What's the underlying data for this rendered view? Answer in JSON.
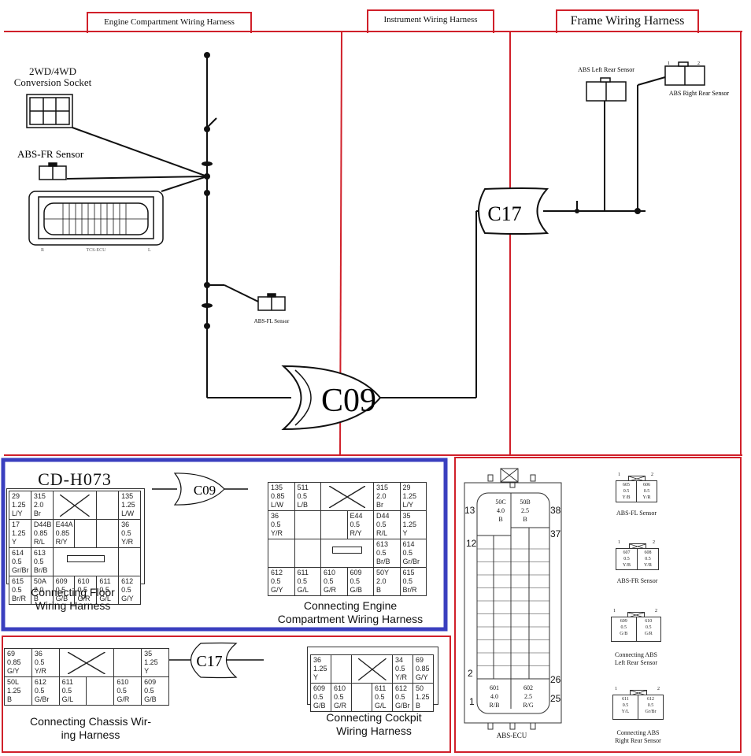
{
  "headers": {
    "engine": "Engine Compartment Wiring Harness",
    "instrument": "Instrument Wiring Harness",
    "frame": "Frame Wiring Harness"
  },
  "colors": {
    "frame_red": "#d0202a",
    "highlight_blue": "#3a3fbf"
  },
  "top_diagram": {
    "conversion_socket": "2WD/4WD\nConversion Socket",
    "abs_fr_sensor": "ABS-FR Sensor",
    "tcs_ecu": "TCS-ECU",
    "tcs_left": "R",
    "tcs_right": "L",
    "abs_fl_sensor": "ABS-FL Sensor",
    "connector_c09": "C09",
    "connector_c17": "C17",
    "abs_left_rear": "ABS Left Rear Sensor",
    "abs_right_rear": "ABS Right Rear Sensor",
    "pin1": "1",
    "pin2": "2"
  },
  "floor_harness": {
    "code": "CD-H073",
    "label": "Connecting Floor\nWiring Harness",
    "rows": [
      [
        {
          "t": "29\n1.25\nL/Y"
        },
        {
          "t": "315\n2.0\nBr"
        },
        {
          "k": "cross",
          "span": 2
        },
        {
          "t": ""
        },
        {
          "t": "135\n1.25\nL/W"
        }
      ],
      [
        {
          "t": "17\n1.25\nY"
        },
        {
          "t": "D44B\n0.85\nR/L"
        },
        {
          "t": "E44A\n0.85\nR/Y"
        },
        {
          "t": ""
        },
        {
          "t": ""
        },
        {
          "t": "36\n0.5\nY/R"
        }
      ],
      [
        {
          "t": "614\n0.5\nGr/Br"
        },
        {
          "t": "613\n0.5\nBr/B"
        },
        {
          "k": "bar",
          "span": 3
        },
        {
          "t": ""
        }
      ],
      [
        {
          "t": "615\n0.5\nBr/R"
        },
        {
          "t": "50A\n2.0\nB"
        },
        {
          "t": "609\n0.5\nG/B"
        },
        {
          "t": "610\n0.5\nG/R"
        },
        {
          "t": "611\n0.5\nG/L"
        },
        {
          "t": "612\n0.5\nG/Y"
        }
      ]
    ]
  },
  "link_c09": "C09",
  "engine_harness": {
    "label": "Connecting Engine\nCompartment Wiring Harness",
    "rows": [
      [
        {
          "t": "135\n0.85\nL/W"
        },
        {
          "t": "511\n0.5\nL/B"
        },
        {
          "k": "cross",
          "span": 2
        },
        {
          "t": "315\n2.0\nBr"
        },
        {
          "t": "29\n1.25\nL/Y"
        }
      ],
      [
        {
          "t": "36\n0.5\nY/R"
        },
        {
          "t": ""
        },
        {
          "t": ""
        },
        {
          "t": "E44\n0.5\nR/Y"
        },
        {
          "t": "D44\n0.5\nR/L"
        },
        {
          "t": "35\n1.25\nY"
        }
      ],
      [
        {
          "t": ""
        },
        {
          "t": ""
        },
        {
          "k": "bar",
          "span": 2
        },
        {
          "t": "613\n0.5\nBr/B"
        },
        {
          "t": "614\n0.5\nGr/Br"
        }
      ],
      [
        {
          "t": "612\n0.5\nG/Y"
        },
        {
          "t": "611\n0.5\nG/L"
        },
        {
          "t": "610\n0.5\nG/R"
        },
        {
          "t": "609\n0.5\nG/B"
        },
        {
          "t": "50Y\n2.0\nB"
        },
        {
          "t": "615\n0.5\nBr/R"
        }
      ]
    ]
  },
  "chassis_harness": {
    "label": "Connecting Chassis Wir-\ning Harness",
    "rows": [
      [
        {
          "t": "69\n0.85\nG/Y"
        },
        {
          "t": "36\n0.5\nY/R"
        },
        {
          "k": "cross",
          "span": 2
        },
        {
          "t": ""
        },
        {
          "t": "35\n1.25\nY"
        }
      ],
      [
        {
          "t": "50L\n1.25\nB"
        },
        {
          "t": "612\n0.5\nG/Br"
        },
        {
          "t": "611\n0.5\nG/L"
        },
        {
          "t": ""
        },
        {
          "t": "610\n0.5\nG/R"
        },
        {
          "t": "609\n0.5\nG/B"
        }
      ]
    ]
  },
  "link_c17": "C17",
  "cockpit_harness": {
    "label": "Connecting Cockpit\nWiring Harness",
    "rows": [
      [
        {
          "t": "36\n1.25\nY"
        },
        {
          "t": ""
        },
        {
          "k": "cross",
          "span": 2
        },
        {
          "t": "34\n0.5\nY/R"
        },
        {
          "t": "69\n0.85\nG/Y"
        }
      ],
      [
        {
          "t": "609\n0.5\nG/B"
        },
        {
          "t": "610\n0.5\nG/R"
        },
        {
          "t": ""
        },
        {
          "t": "611\n0.5\nG/L"
        },
        {
          "t": "612\n0.5\nG/Br"
        },
        {
          "t": "50\n1.25\nB"
        }
      ]
    ]
  },
  "abs_ecu": {
    "label": "ABS-ECU",
    "pin_numbers": {
      "p13": "13",
      "p38": "38",
      "p12": "12",
      "p37": "37",
      "p2": "2",
      "p26": "26",
      "p1": "1",
      "p25": "25"
    },
    "pin_50c": "50C\n4.0\nB",
    "pin_50b": "50B\n2.5\nB",
    "pin_601": "601\n4.0\nR/B",
    "pin_602": "602\n2.5\nR/G"
  },
  "sensors": [
    {
      "label": "ABS-FL Sensor",
      "cells": [
        "605\n0.5\nY/B",
        "606\n0.5\nY/R"
      ]
    },
    {
      "label": "ABS-FR Sensor",
      "cells": [
        "607\n0.5\nY/B",
        "608\n0.5\nY/R"
      ]
    },
    {
      "label": "Connecting ABS\nLeft Rear Sensor",
      "cells": [
        "609\n0.5\nG/B",
        "610\n0.5\nG/R"
      ]
    },
    {
      "label": "Connecting ABS\nRight Rear Sensor",
      "cells": [
        "611\n0.5\nY/L",
        "612\n0.5\nGr/Br"
      ]
    }
  ]
}
